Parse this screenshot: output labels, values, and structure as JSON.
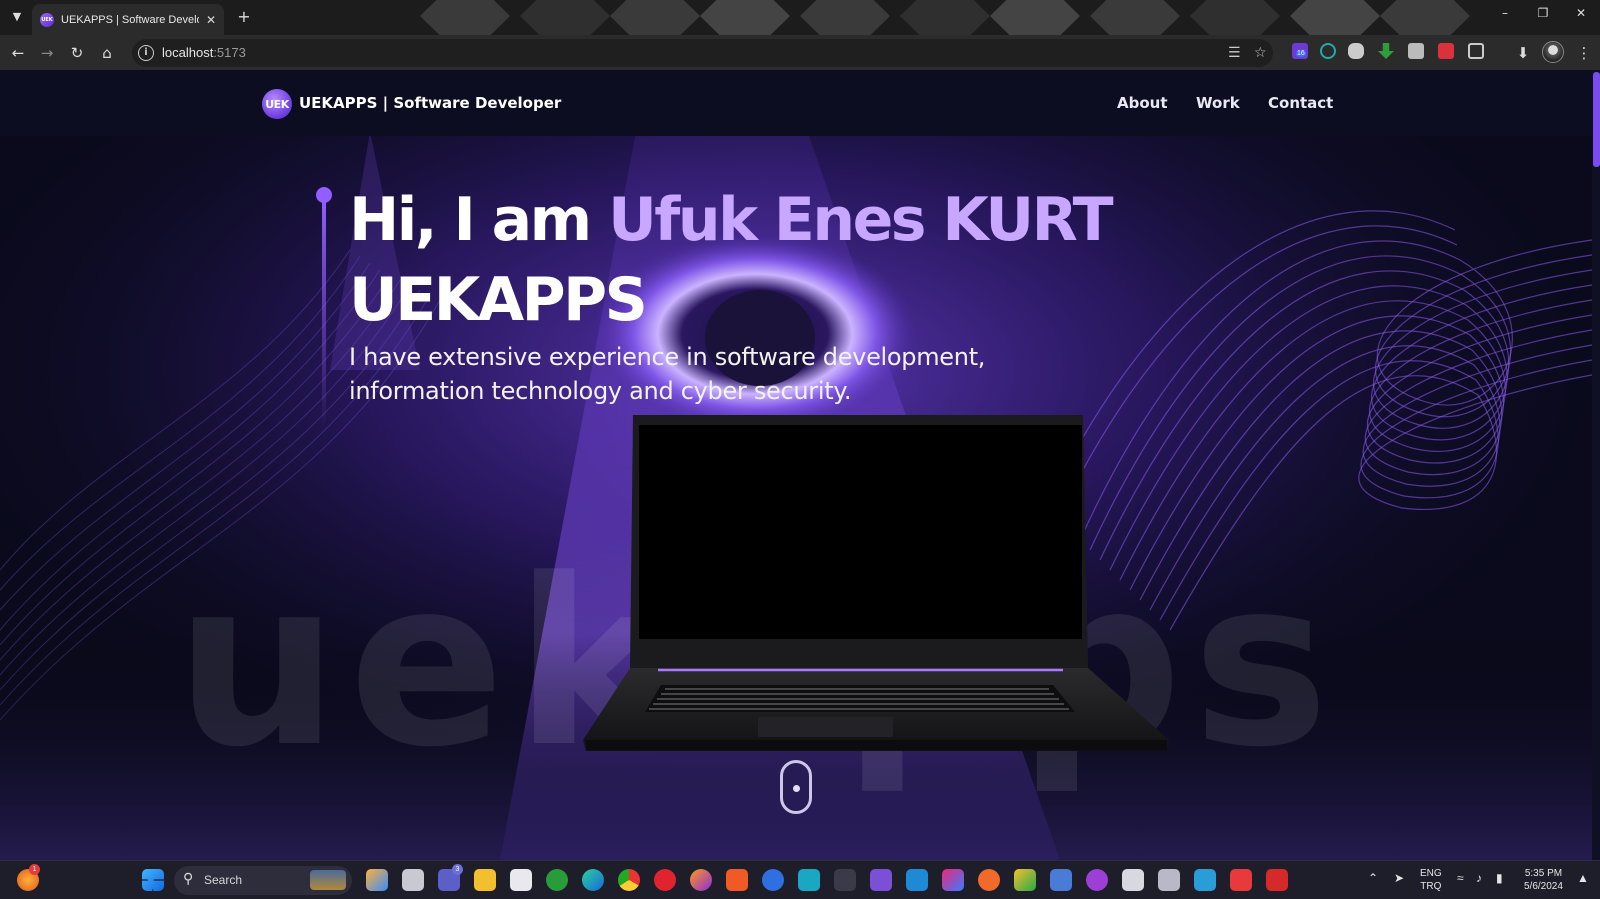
{
  "browser": {
    "tab_title": "UEKAPPS | Software Developer",
    "favicon_text": "UEK",
    "url_host": "localhost",
    "url_port": ":5173"
  },
  "site": {
    "logo_text": "UEK",
    "brand": "UEKAPPS | Software Developer",
    "nav": [
      {
        "label": "About"
      },
      {
        "label": "Work"
      },
      {
        "label": "Contact"
      }
    ],
    "hero": {
      "greeting": "Hi, I am ",
      "name": "Ufuk Enes KURT",
      "title2": "UEKAPPS",
      "subtitle_line1": "I have extensive experience in software development,",
      "subtitle_line2": "information technology and cyber security.",
      "watermark": "uekapps"
    }
  },
  "taskbar": {
    "search_label": "Search",
    "teams_badge": "3",
    "lang_line1": "ENG",
    "lang_line2": "TRQ",
    "time": "5:35 PM",
    "date": "5/6/2024",
    "notification_badge": "1",
    "extension_badge": "16"
  },
  "colors": {
    "accent": "#915eff",
    "highlight": "#c7a7ff",
    "nav_bg": "#0d0d22"
  }
}
